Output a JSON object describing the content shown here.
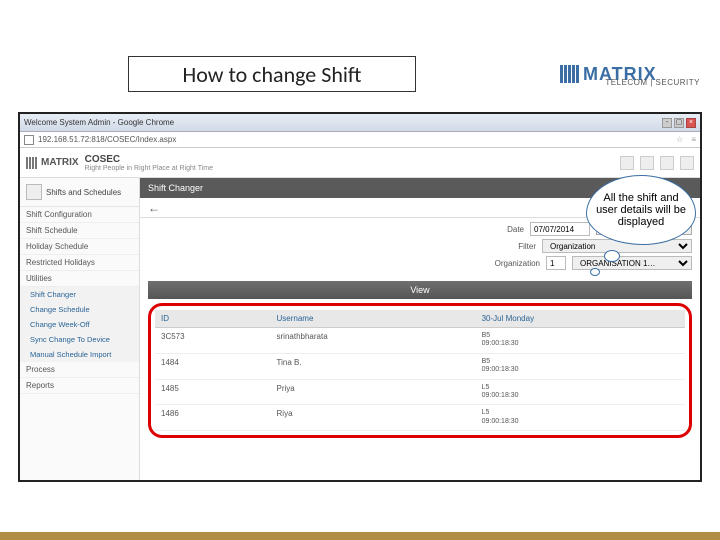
{
  "slide": {
    "title": "How to change Shift",
    "callout": "All the shift and user details will be displayed"
  },
  "brand": {
    "name": "MATRIX",
    "sub": "TELECOM | SECURITY"
  },
  "chrome": {
    "tab_title": "Welcome System Admin - Google Chrome",
    "url": "192.168.51.72:818/COSEC/Index.aspx"
  },
  "app": {
    "logo": "MATRIX",
    "product": "COSEC",
    "tagline": "Right People in Right Place at Right Time"
  },
  "sidebar": {
    "section_title": "Shifts and Schedules",
    "items": [
      "Shift Configuration",
      "Shift Schedule",
      "Holiday Schedule",
      "Restricted Holidays",
      "Utilities"
    ],
    "utilities": [
      "Shift Changer",
      "Change Schedule",
      "Change Week-Off",
      "Sync Change To Device",
      "Manual Schedule Import"
    ],
    "bottom": [
      "Process",
      "Reports"
    ]
  },
  "page": {
    "header": "Shift Changer",
    "labels": {
      "date": "Date",
      "filter": "Filter",
      "organization": "Organization"
    },
    "date_from": "07/07/2014",
    "date_to": "07/07/2014",
    "filter_value": "Organization",
    "org_code": "1",
    "org_value": "ORGANISATION 1…",
    "view_btn": "View"
  },
  "table": {
    "cols": [
      "ID",
      "Username",
      "30-Jul Monday"
    ],
    "rows": [
      {
        "id": "3C573",
        "user": "srinathbharata",
        "shift": "B5\n09:00:18:30"
      },
      {
        "id": "1484",
        "user": "Tina B.",
        "shift": "B5\n09:00:18:30"
      },
      {
        "id": "1485",
        "user": "Priya",
        "shift": "L5\n09:00:18:30"
      },
      {
        "id": "1486",
        "user": "Riya",
        "shift": "L5\n09:00:18:30"
      }
    ]
  }
}
